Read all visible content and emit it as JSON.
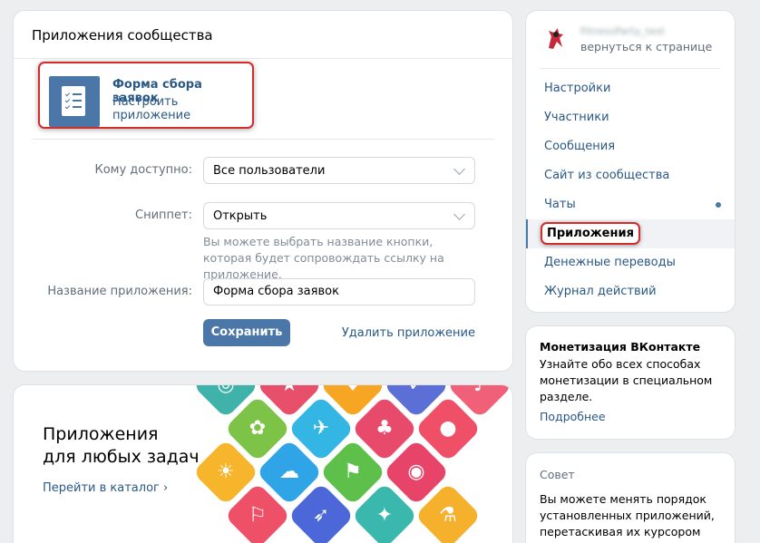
{
  "main": {
    "title": "Приложения сообщества",
    "app": {
      "name": "Форма сбора заявок",
      "setup_link": "Настроить приложение"
    },
    "form": {
      "access_label": "Кому доступно:",
      "access_value": "Все пользователи",
      "snippet_label": "Сниппет:",
      "snippet_value": "Открыть",
      "snippet_hint": "Вы можете выбрать название кнопки, которая будет сопровождать ссылку на приложение.",
      "name_label": "Название приложения:",
      "name_value": "Форма сбора заявок"
    },
    "save_button": "Сохранить",
    "delete_link": "Удалить приложение"
  },
  "promo": {
    "title_line1": "Приложения",
    "title_line2": "для любых задач",
    "catalog_link": "Перейти в каталог ›"
  },
  "sidebar": {
    "profile_name": "FitnessParty_test",
    "back_link": "вернуться к странице",
    "items": [
      {
        "label": "Настройки"
      },
      {
        "label": "Участники"
      },
      {
        "label": "Сообщения"
      },
      {
        "label": "Сайт из сообщества"
      },
      {
        "label": "Чаты"
      },
      {
        "label": "Приложения"
      },
      {
        "label": "Денежные переводы"
      },
      {
        "label": "Журнал действий"
      }
    ],
    "active_item": "Приложения"
  },
  "monetization": {
    "title": "Монетизация ВКонтакте",
    "text": "Узнайте обо всех способах монетизации в специальном разделе.",
    "link": "Подробнее"
  },
  "tip": {
    "title": "Совет",
    "text": "Вы можете менять порядок установленных приложений, перетаскивая их курсором"
  },
  "colors": {
    "accent": "#4a76a8",
    "link": "#2a5885",
    "highlight_border": "#d42b2b",
    "background": "#edeef0"
  }
}
